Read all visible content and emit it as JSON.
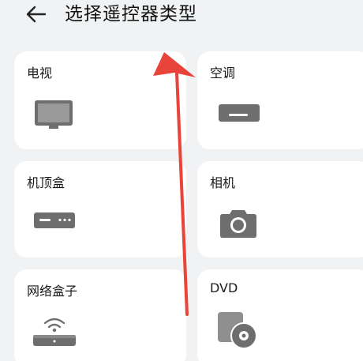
{
  "header": {
    "title": "选择遥控器类型",
    "back_icon": "arrow-left-icon"
  },
  "devices": [
    {
      "label": "电视",
      "icon": "tv-icon"
    },
    {
      "label": "空调",
      "icon": "air-conditioner-icon"
    },
    {
      "label": "机顶盒",
      "icon": "set-top-box-icon"
    },
    {
      "label": "相机",
      "icon": "camera-icon"
    },
    {
      "label": "网络盒子",
      "icon": "network-box-icon"
    },
    {
      "label": "DVD",
      "icon": "dvd-icon"
    }
  ],
  "colors": {
    "background": "#f1f2f4",
    "card": "#ffffff",
    "icon": "#6e6e6e",
    "annotation_arrow": "#e8443a"
  }
}
